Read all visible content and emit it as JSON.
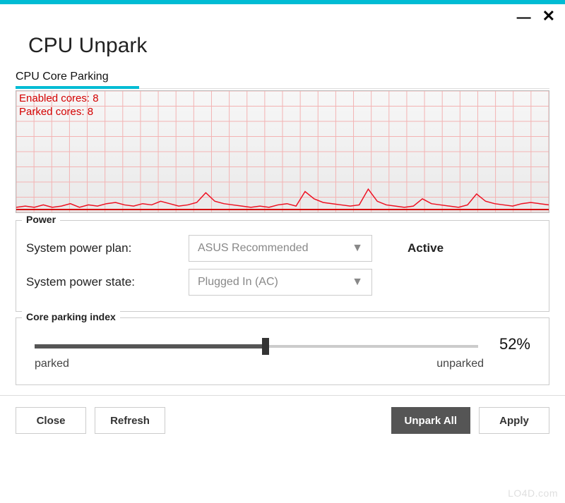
{
  "window": {
    "title": "CPU Unpark"
  },
  "section": {
    "header": "CPU Core Parking"
  },
  "graph_labels": {
    "enabled": "Enabled cores: 8",
    "parked": "Parked cores:  8"
  },
  "power": {
    "legend": "Power",
    "plan_label": "System power plan:",
    "plan_value": "ASUS Recommended",
    "plan_status": "Active",
    "state_label": "System power state:",
    "state_value": "Plugged In (AC)"
  },
  "core_index": {
    "legend": "Core parking index",
    "percent": "52%",
    "value": 52,
    "left_label": "parked",
    "right_label": "unparked"
  },
  "buttons": {
    "close": "Close",
    "refresh": "Refresh",
    "unpark_all": "Unpark All",
    "apply": "Apply"
  },
  "chart_data": {
    "type": "line",
    "title": "CPU Core Parking",
    "xlabel": "",
    "ylabel": "",
    "ylim": [
      0,
      100
    ],
    "x": [
      0,
      1,
      2,
      3,
      4,
      5,
      6,
      7,
      8,
      9,
      10,
      11,
      12,
      13,
      14,
      15,
      16,
      17,
      18,
      19,
      20,
      21,
      22,
      23,
      24,
      25,
      26,
      27,
      28,
      29,
      30,
      31,
      32,
      33,
      34,
      35,
      36,
      37,
      38,
      39,
      40,
      41,
      42,
      43,
      44,
      45,
      46,
      47,
      48,
      49,
      50,
      51,
      52,
      53,
      54,
      55,
      56,
      57,
      58,
      59
    ],
    "values": [
      3,
      4,
      3,
      5,
      3,
      4,
      6,
      3,
      5,
      4,
      6,
      7,
      5,
      4,
      6,
      5,
      8,
      6,
      4,
      5,
      7,
      15,
      8,
      6,
      5,
      4,
      3,
      4,
      3,
      5,
      6,
      4,
      16,
      10,
      7,
      6,
      5,
      4,
      5,
      18,
      8,
      5,
      4,
      3,
      4,
      10,
      6,
      5,
      4,
      3,
      5,
      14,
      8,
      6,
      5,
      4,
      6,
      7,
      6,
      5
    ]
  },
  "watermark": "LO4D.com"
}
